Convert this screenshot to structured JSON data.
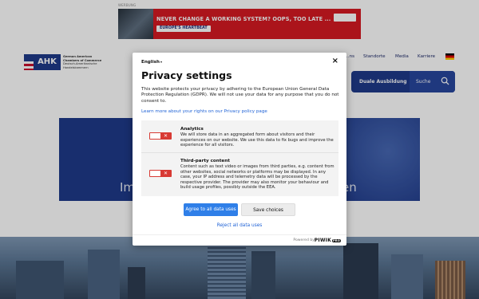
{
  "ad": {
    "label": "WERBUNG",
    "headline": "NEVER CHANGE A WORKING SYSTEM? OOPS, TOO LATE ...",
    "pill": "EUROPE'S HEARTBEAT"
  },
  "header": {
    "logo_abbr": "AHK",
    "logo_lines": [
      "German American",
      "Chambers of Commerce",
      "Deutsch-Amerikanische",
      "Handelskammern"
    ],
    "topnav": [
      "…ns",
      "Standorte",
      "Media",
      "Karriere"
    ],
    "nav_item": "Duale Ausbildung",
    "search_label": "Suche",
    "search_icon": "search-icon",
    "lang_flag": "german-flag-icon"
  },
  "hero": {
    "left_text": "Im",
    "right_text": "en"
  },
  "modal": {
    "language": "English",
    "close_label": "×",
    "title": "Privacy settings",
    "description": "This website protects your privacy by adhering to the European Union General Data Protection Regulation (GDPR). We will not use your data for any purpose that you do not consent to.",
    "learn_more": "Learn more about your rights on our Privacy policy page",
    "categories": [
      {
        "title": "Analytics",
        "description": "We will store data in an aggregated form about visitors and their experiences on our website. We use this data to fix bugs and improve the experience for all visitors.",
        "enabled": false
      },
      {
        "title": "Third-party content",
        "description": "Content such as text video or images from third parties, e.g. content from other websites, social networks or platforms may be displayed. In any case, your IP address and telemetry data will be processed by the respective provider. The provider may also monitor your behaviour and build usage profiles, possibly outside the EEA.",
        "enabled": false
      }
    ],
    "agree_button": "Agree to all data uses",
    "save_button": "Save choices",
    "reject_link": "Reject all data uses",
    "powered_by": "Powered by",
    "brand": "PIWIK",
    "brand_badge": "PRO"
  },
  "colors": {
    "brand_blue": "#1f3a8a",
    "accent_blue": "#2f7fe8",
    "toggle_red": "#d83a34",
    "ad_red": "#d61a22"
  }
}
